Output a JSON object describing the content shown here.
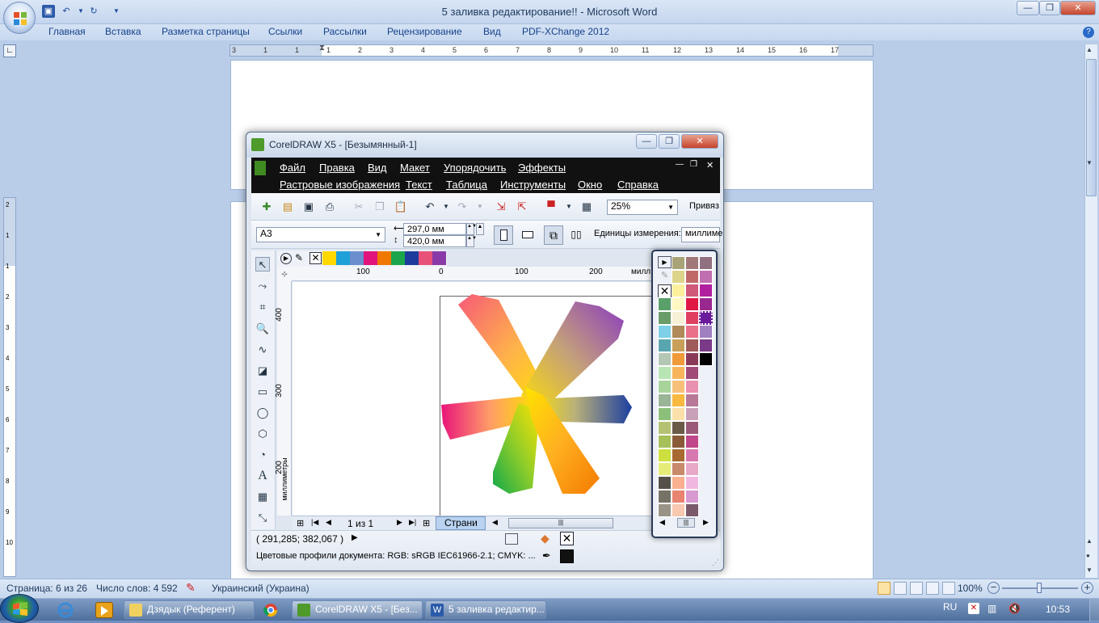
{
  "word": {
    "title": "5 заливка редактирование!! - Microsoft Word",
    "tabs": [
      "Главная",
      "Вставка",
      "Разметка страницы",
      "Ссылки",
      "Рассылки",
      "Рецензирование",
      "Вид",
      "PDF-XChange 2012"
    ],
    "status": {
      "page": "Страница: 6 из 26",
      "words": "Число слов: 4 592",
      "language": "Украинский (Украина)",
      "zoom": "100%"
    },
    "ruler_labels": [
      "3",
      "1",
      "1",
      "1",
      "2",
      "3",
      "4",
      "5",
      "6",
      "7",
      "8",
      "9",
      "10",
      "11",
      "12",
      "13",
      "14",
      "15",
      "16",
      "17"
    ],
    "vruler_labels": [
      "2",
      "1",
      "1",
      "2",
      "3",
      "4",
      "5",
      "6",
      "7",
      "8",
      "9",
      "10"
    ]
  },
  "corel": {
    "title": "CorelDRAW X5 - [Безымянный-1]",
    "menu_row1": [
      "Файл",
      "Правка",
      "Вид",
      "Макет",
      "Упорядочить",
      "Эффекты"
    ],
    "menu_row2": [
      "Растровые изображения",
      "Текст",
      "Таблица",
      "Инструменты",
      "Окно",
      "Справка"
    ],
    "zoom": "25%",
    "snap_label": "Привяз",
    "page_size": "A3",
    "width": "297,0 мм",
    "height": "420,0 мм",
    "units_label": "Единицы измерения:",
    "units_value": "миллиме",
    "hruler_labels": [
      "100",
      "0",
      "100",
      "200",
      "милл"
    ],
    "vruler_labels": [
      "400",
      "300",
      "200"
    ],
    "vruler_unit": "миллиметры",
    "page_indicator": "1 из 1",
    "page_tab": "Страни",
    "coords": "( 291,285; 382,067 )",
    "color_profiles": "Цветовые профили документа: RGB: sRGB IEC61966-2.1; CMYK: ...",
    "palette_strip": [
      "#ffd800",
      "#1ea0d8",
      "#6b8ecf",
      "#e0147a",
      "#f07800",
      "#1aa54a",
      "#1d3b9c",
      "#e8527a",
      "#8a3aa8"
    ]
  },
  "taskbar": {
    "items": [
      {
        "label": "Дзядык (Референт)"
      },
      {
        "label": "CorelDRAW X5 - [Без..."
      },
      {
        "label": "5 заливка редактир..."
      }
    ],
    "lang": "RU",
    "time": "10:53"
  }
}
